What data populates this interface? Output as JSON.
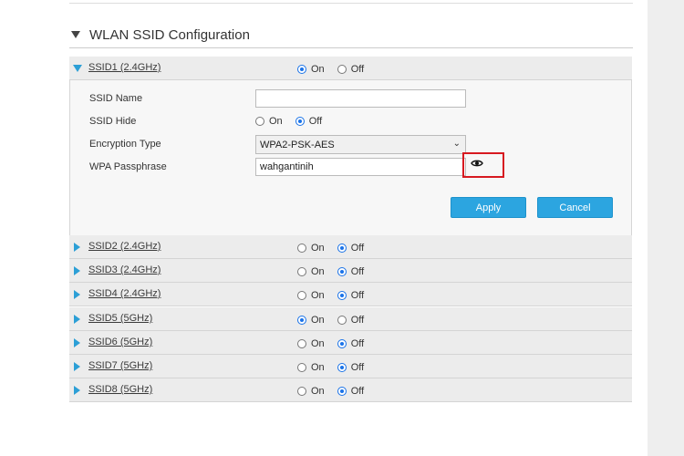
{
  "section": {
    "title": "WLAN SSID Configuration"
  },
  "expanded_ssid": {
    "name": "SSID1 (2.4GHz)",
    "enabled": "On",
    "on_label": "On",
    "off_label": "Off",
    "fields": {
      "ssid_name_label": "SSID Name",
      "ssid_name_value": "",
      "ssid_hide_label": "SSID Hide",
      "ssid_hide_value": "Off",
      "encryption_label": "Encryption Type",
      "encryption_value": "WPA2-PSK-AES",
      "passphrase_label": "WPA Passphrase",
      "passphrase_value": "wahgantinih"
    },
    "apply_label": "Apply",
    "cancel_label": "Cancel"
  },
  "ssid_rows": [
    {
      "name": "SSID2 (2.4GHz)",
      "selected": "Off",
      "on_label": "On",
      "off_label": "Off"
    },
    {
      "name": "SSID3 (2.4GHz)",
      "selected": "Off",
      "on_label": "On",
      "off_label": "Off"
    },
    {
      "name": "SSID4 (2.4GHz)",
      "selected": "Off",
      "on_label": "On",
      "off_label": "Off"
    },
    {
      "name": "SSID5 (5GHz)",
      "selected": "On",
      "on_label": "On",
      "off_label": "Off"
    },
    {
      "name": "SSID6 (5GHz)",
      "selected": "Off",
      "on_label": "On",
      "off_label": "Off"
    },
    {
      "name": "SSID7 (5GHz)",
      "selected": "Off",
      "on_label": "On",
      "off_label": "Off"
    },
    {
      "name": "SSID8 (5GHz)",
      "selected": "Off",
      "on_label": "On",
      "off_label": "Off"
    }
  ],
  "icons": {
    "section_toggle": "triangle-down-icon",
    "row_expand": "triangle-right-icon",
    "password_toggle": "eye-icon"
  },
  "colors": {
    "accent": "#2ca5e0",
    "highlight_border": "#d71920",
    "radio_selected": "#1a73e8"
  }
}
